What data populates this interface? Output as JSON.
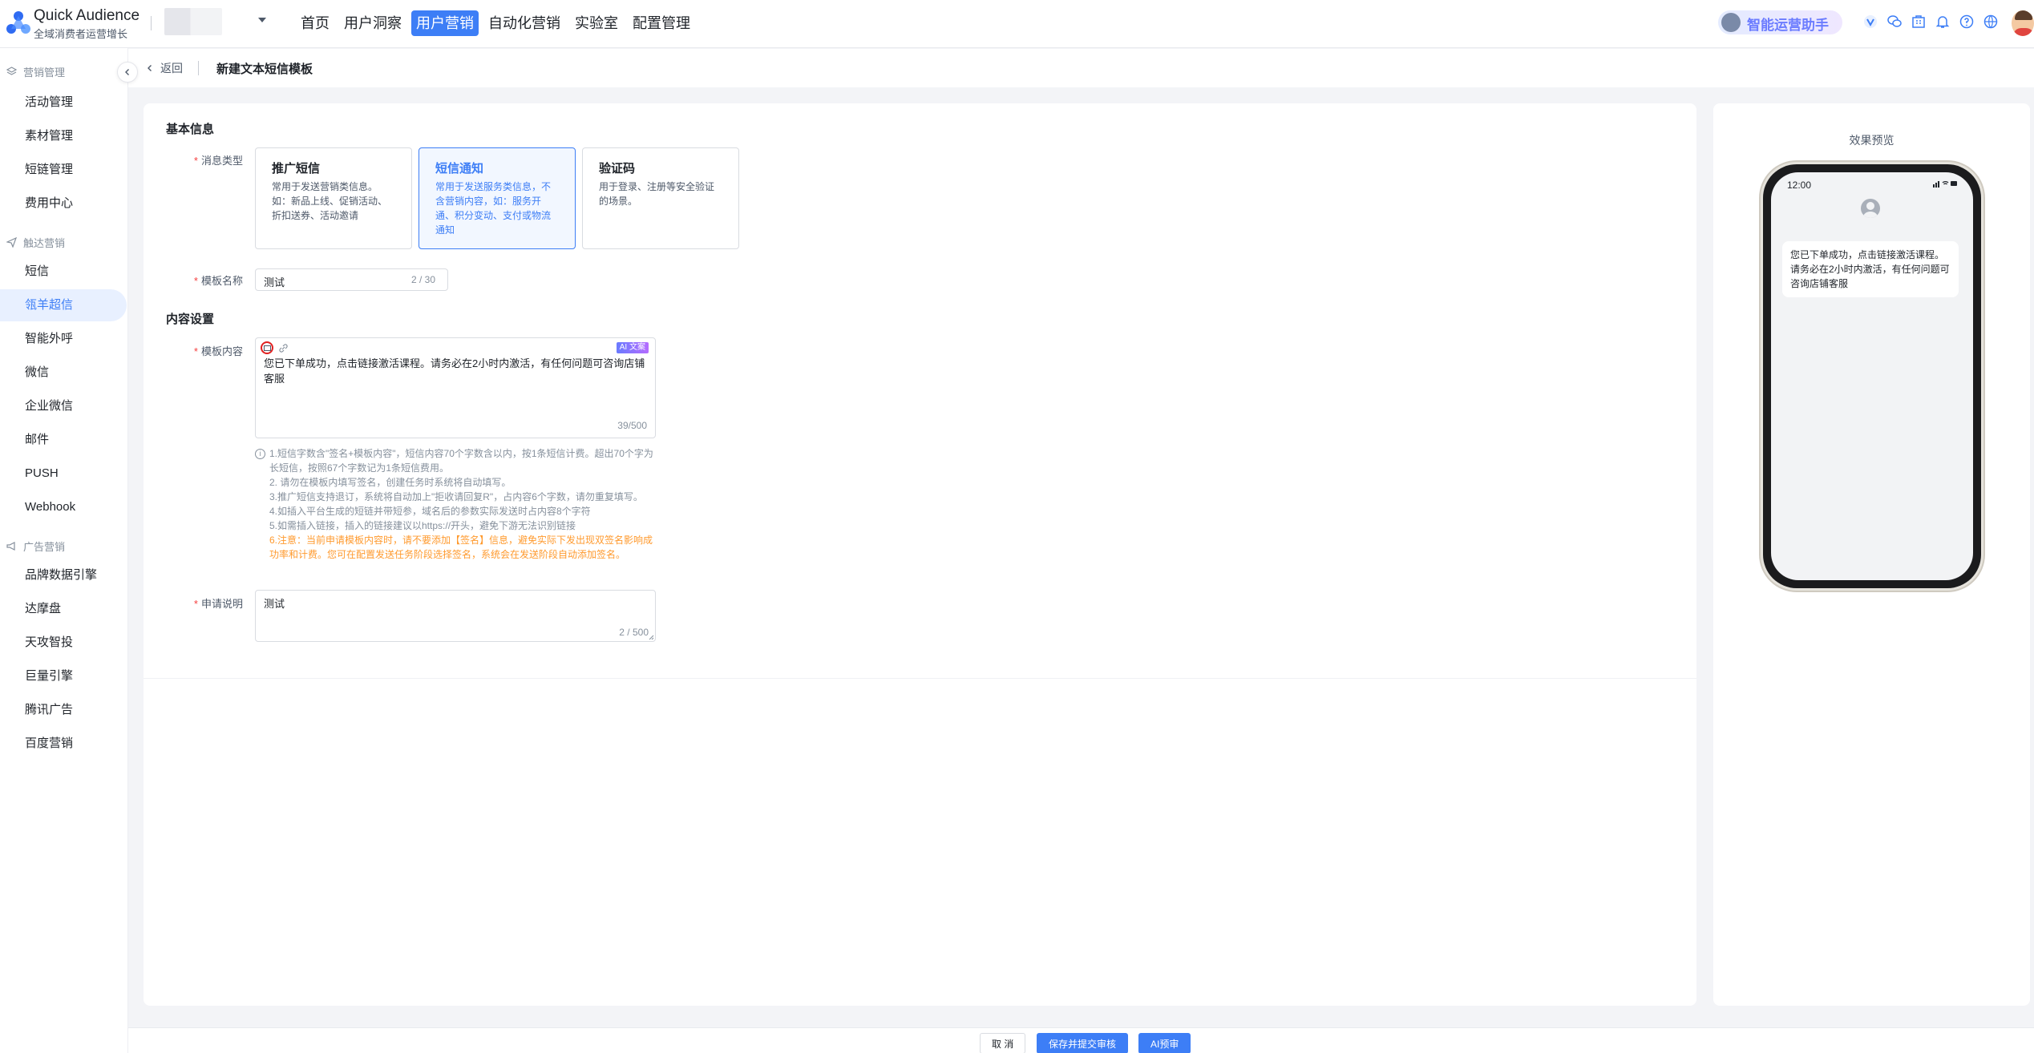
{
  "brand": {
    "name": "Quick Audience",
    "subtitle": "全域消费者运营增长"
  },
  "nav": {
    "items": [
      "首页",
      "用户洞察",
      "用户营销",
      "自动化营销",
      "实验室",
      "配置管理"
    ],
    "active_index": 2
  },
  "assistant": {
    "label": "智能运营助手"
  },
  "topbar_icons": [
    "v-badge-icon",
    "wechat-icon",
    "building-icon",
    "bell-icon",
    "help-icon",
    "globe-icon"
  ],
  "sidebar": {
    "groups": [
      {
        "label": "营销管理",
        "items": [
          "活动管理",
          "素材管理",
          "短链管理",
          "费用中心"
        ]
      },
      {
        "label": "触达营销",
        "items": [
          "短信",
          "瓴羊超信",
          "智能外呼",
          "微信",
          "企业微信",
          "邮件",
          "PUSH",
          "Webhook"
        ]
      },
      {
        "label": "广告营销",
        "items": [
          "品牌数据引擎",
          "达摩盘",
          "天攻智投",
          "巨量引擎",
          "腾讯广告",
          "百度营销"
        ]
      }
    ],
    "active_item": "瓴羊超信"
  },
  "breadcrumb": {
    "back": "返回",
    "title": "新建文本短信模板"
  },
  "form": {
    "basic_title": "基本信息",
    "msg_type_label": "消息类型",
    "types": [
      {
        "title": "推广短信",
        "desc": "常用于发送营销类信息。如：新品上线、促销活动、折扣送券、活动邀请",
        "selected": false
      },
      {
        "title": "短信通知",
        "desc": "常用于发送服务类信息，不含营销内容，如：服务开通、积分变动、支付或物流通知",
        "selected": true
      },
      {
        "title": "验证码",
        "desc": "用于登录、注册等安全验证的场景。",
        "selected": false
      }
    ],
    "name_label": "模板名称",
    "name_value": "测试",
    "name_counter": "2 / 30",
    "content_title": "内容设置",
    "content_label": "模板内容",
    "content_value": "您已下单成功，点击链接激活课程。请务必在2小时内激活，有任何问题可咨询店铺客服",
    "content_counter": "39/500",
    "ai_badge": "AI 文案",
    "tips": [
      "1.短信字数含\"签名+模板内容\"，短信内容70个字数含以内，按1条短信计费。超出70个字为长短信，按照67个字数记为1条短信费用。",
      "2. 请勿在模板内填写签名，创建任务时系统将自动填写。",
      "3.推广短信支持退订，系统将自动加上\"拒收请回复R\"，占内容6个字数，请勿重复填写。",
      "4.如插入平台生成的短链并带短参，域名后的参数实际发送时占内容8个字符",
      "5.如需插入链接，插入的链接建议以https://开头，避免下游无法识别链接"
    ],
    "warning": "6.注意：当前申请模板内容时，请不要添加【签名】信息，避免实际下发出现双签名影响成功率和计费。您可在配置发送任务阶段选择签名，系统会在发送阶段自动添加签名。",
    "apply_label": "申请说明",
    "apply_value": "测试",
    "apply_counter": "2 / 500"
  },
  "preview": {
    "title": "效果预览",
    "time": "12:00",
    "message": "您已下单成功，点击链接激活课程。请务必在2小时内激活，有任何问题可咨询店铺客服"
  },
  "footer": {
    "cancel": "取 消",
    "submit": "保存并提交审核",
    "ai_review": "AI预审"
  },
  "colors": {
    "primary": "#3d7ef6",
    "warning": "#ff9a2e",
    "required": "#f53f3f"
  }
}
